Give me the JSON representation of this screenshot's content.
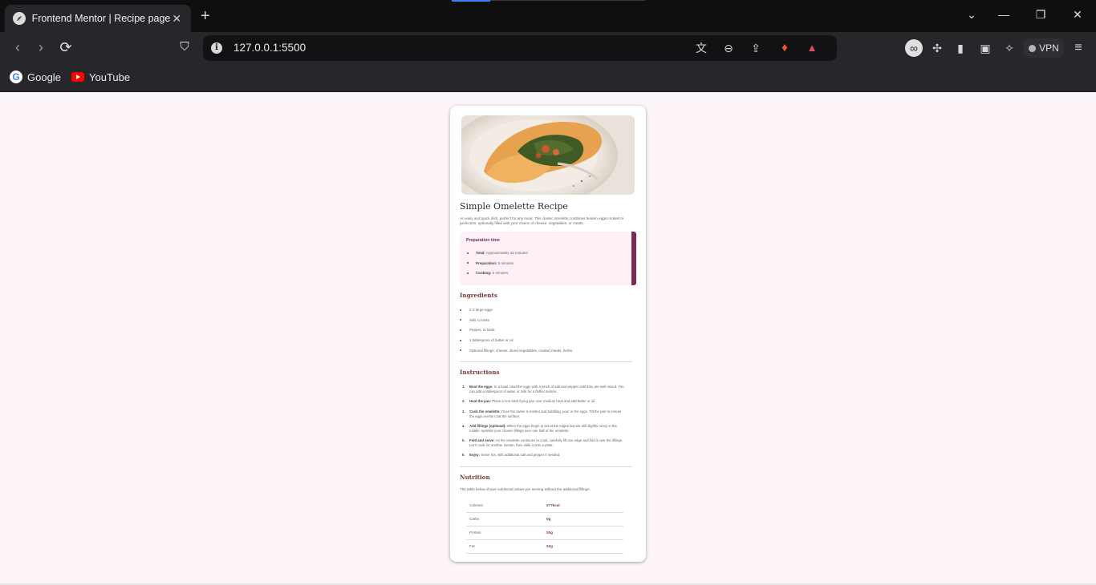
{
  "browser": {
    "tab_title": "Frontend Mentor | Recipe page",
    "url": "127.0.0.1:5500",
    "vpn_label": "VPN",
    "bookmarks": [
      {
        "label": "Google"
      },
      {
        "label": "YouTube"
      }
    ]
  },
  "recipe": {
    "title": "Simple Omelette Recipe",
    "description": "An easy and quick dish, perfect for any meal. This classic omelette combines beaten eggs cooked to perfection, optionally filled with your choice of cheese, vegetables, or meats.",
    "prep": {
      "title": "Preparation time",
      "items": [
        {
          "label": "Total:",
          "value": "Approximately 10 minutes"
        },
        {
          "label": "Preparation:",
          "value": "5 minutes"
        },
        {
          "label": "Cooking:",
          "value": "5 minutes"
        }
      ]
    },
    "ingredients": {
      "title": "Ingredients",
      "items": [
        "2-3 large eggs",
        "Salt, to taste",
        "Pepper, to taste",
        "1 tablespoon of butter or oil",
        "Optional fillings: cheese, diced vegetables, cooked meats, herbs"
      ]
    },
    "instructions": {
      "title": "Instructions",
      "items": [
        {
          "num": "1.",
          "label": "Beat the eggs:",
          "text": "In a bowl, beat the eggs with a pinch of salt and pepper until they are well mixed. You can add a tablespoon of water or milk for a fluffier texture."
        },
        {
          "num": "2.",
          "label": "Heat the pan:",
          "text": "Place a non-stick frying pan over medium heat and add butter or oil."
        },
        {
          "num": "3.",
          "label": "Cook the omelette:",
          "text": "Once the butter is melted and bubbling, pour in the eggs. Tilt the pan to ensure the eggs evenly coat the surface."
        },
        {
          "num": "4.",
          "label": "Add fillings (optional):",
          "text": "When the eggs begin to set at the edges but are still slightly runny in the middle, sprinkle your chosen fillings over one half of the omelette."
        },
        {
          "num": "5.",
          "label": "Fold and serve:",
          "text": "As the omelette continues to cook, carefully lift one edge and fold it over the fillings. Let it cook for another minute, then slide it onto a plate."
        },
        {
          "num": "6.",
          "label": "Enjoy:",
          "text": "Serve hot, with additional salt and pepper if needed."
        }
      ]
    },
    "nutrition": {
      "title": "Nutrition",
      "description": "The table below shows nutritional values per serving without the additional fillings.",
      "rows": [
        {
          "name": "Calories",
          "value": "277kcal"
        },
        {
          "name": "Carbs",
          "value": "0g"
        },
        {
          "name": "Protein",
          "value": "20g"
        },
        {
          "name": "Fat",
          "value": "22g"
        }
      ]
    }
  },
  "colors": {
    "page_bg": "#fdf5f9",
    "accent": "#7a2a55",
    "heading": "#7a3a3a",
    "prep_bg": "#fdf0f6"
  }
}
